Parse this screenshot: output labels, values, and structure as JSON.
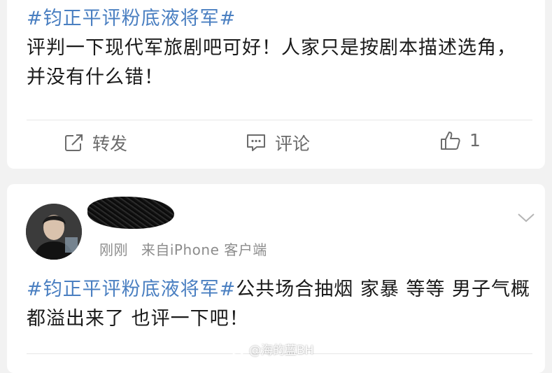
{
  "post1": {
    "hashtag": "#钧正平评粉底液将军#",
    "text": "评判一下现代军旅剧吧可好！人家只是按剧本描述选角，并没有什么错！",
    "actions": {
      "repost_label": "转发",
      "comment_label": "评论",
      "like_count": "1"
    }
  },
  "post2": {
    "time": "刚刚",
    "source": "来自iPhone 客户端",
    "hashtag": "#钧正平评粉底液将军#",
    "text": "公共场合抽烟 家暴 等等 男子气概都溢出来了 也评一下吧！"
  },
  "watermark": {
    "text": "@海的蓝BH"
  },
  "colors": {
    "hashtag": "#4a7fc1",
    "background": "#f2f2f2",
    "card": "#ffffff",
    "muted": "#8c8c8c"
  }
}
